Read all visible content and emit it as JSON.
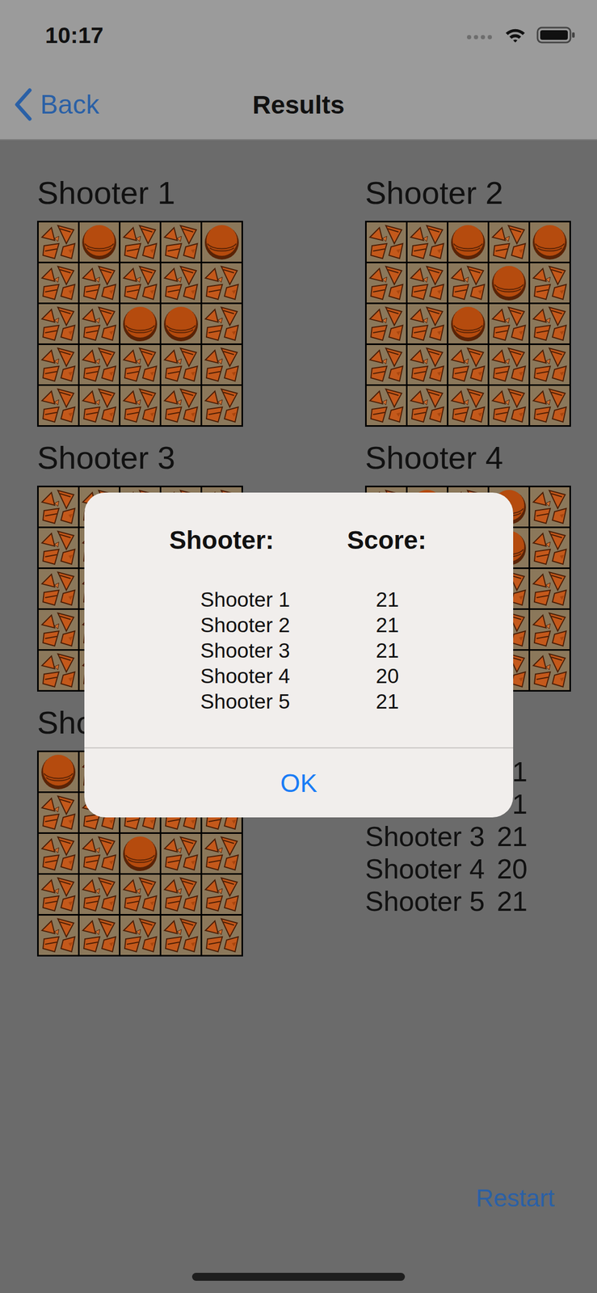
{
  "status_bar": {
    "time": "10:17"
  },
  "nav": {
    "back": "Back",
    "title": "Results"
  },
  "shooters": [
    {
      "label": "Shooter 1",
      "broken": [
        [
          true,
          false,
          true,
          true,
          false
        ],
        [
          true,
          true,
          true,
          true,
          true
        ],
        [
          true,
          true,
          false,
          false,
          true
        ],
        [
          true,
          true,
          true,
          true,
          true
        ],
        [
          true,
          true,
          true,
          true,
          true
        ]
      ]
    },
    {
      "label": "Shooter 2",
      "broken": [
        [
          true,
          true,
          false,
          true,
          false
        ],
        [
          true,
          true,
          true,
          false,
          true
        ],
        [
          true,
          true,
          false,
          true,
          true
        ],
        [
          true,
          true,
          true,
          true,
          true
        ],
        [
          true,
          true,
          true,
          true,
          true
        ]
      ]
    },
    {
      "label": "Shooter 3",
      "broken": [
        [
          true,
          true,
          true,
          true,
          true
        ],
        [
          true,
          true,
          false,
          true,
          true
        ],
        [
          true,
          true,
          true,
          false,
          true
        ],
        [
          true,
          true,
          false,
          true,
          true
        ],
        [
          true,
          true,
          true,
          false,
          true
        ]
      ]
    },
    {
      "label": "Shooter 4",
      "broken": [
        [
          true,
          false,
          true,
          false,
          true
        ],
        [
          true,
          true,
          true,
          false,
          true
        ],
        [
          true,
          true,
          false,
          true,
          true
        ],
        [
          false,
          true,
          true,
          true,
          true
        ],
        [
          true,
          true,
          true,
          true,
          true
        ]
      ]
    },
    {
      "label": "Sho",
      "broken": [
        [
          false,
          true,
          false,
          true,
          false
        ],
        [
          true,
          true,
          true,
          true,
          true
        ],
        [
          true,
          true,
          false,
          true,
          true
        ],
        [
          true,
          true,
          true,
          true,
          true
        ],
        [
          true,
          true,
          true,
          true,
          true
        ]
      ]
    }
  ],
  "scoreboard": [
    {
      "name": "",
      "score": "1"
    },
    {
      "name": "",
      "score": "1"
    },
    {
      "name": "Shooter 3",
      "score": "21"
    },
    {
      "name": "Shooter 4",
      "score": "20"
    },
    {
      "name": "Shooter 5",
      "score": "21"
    }
  ],
  "restart": "Restart",
  "alert": {
    "headers": [
      "Shooter:",
      "Score:"
    ],
    "rows": [
      {
        "name": "Shooter 1",
        "score": "21"
      },
      {
        "name": "Shooter 2",
        "score": "21"
      },
      {
        "name": "Shooter 3",
        "score": "21"
      },
      {
        "name": "Shooter 4",
        "score": "20"
      },
      {
        "name": "Shooter 5",
        "score": "21"
      }
    ],
    "buttons": [
      "OK"
    ]
  }
}
